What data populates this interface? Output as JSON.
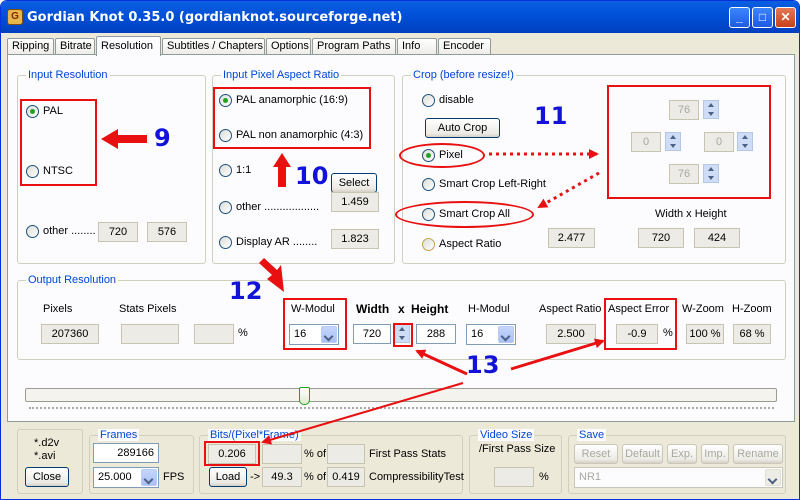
{
  "window": {
    "title": "Gordian Knot 0.35.0  (gordianknot.sourceforge.net)",
    "minimize": "_",
    "maximize": "□",
    "close": "✕"
  },
  "tabs": [
    "Ripping",
    "Bitrate",
    "Resolution",
    "Subtitles / Chapters",
    "Options",
    "Program Paths",
    "Info",
    "Encoder"
  ],
  "input_resolution": {
    "label": "Input Resolution",
    "pal": "PAL",
    "ntsc": "NTSC",
    "other": "other ........",
    "width": "720",
    "height": "576"
  },
  "pixel_aspect": {
    "label": "Input Pixel Aspect Ratio",
    "pal_anamorphic": "PAL anamorphic (16:9)",
    "pal_non_anamorphic": "PAL non anamorphic (4:3)",
    "one_to_one": "1:1",
    "select_button": "Select",
    "select_value": "1.459",
    "other": "other ..................",
    "display_ar": "Display AR ........",
    "display_ar_value": "1.823"
  },
  "crop": {
    "label": "Crop (before resize!)",
    "disable": "disable",
    "auto_crop": "Auto Crop",
    "pixel": "Pixel",
    "smart_left_right": "Smart Crop Left-Right",
    "smart_all": "Smart Crop All",
    "aspect_ratio": "Aspect Ratio",
    "aspect_ratio_value": "2.477",
    "top": "76",
    "left": "0",
    "right": "0",
    "bottom": "76",
    "wh_label": "Width x Height",
    "width": "720",
    "height": "424"
  },
  "output": {
    "label": "Output Resolution",
    "pixels_label": "Pixels",
    "pixels_value": "207360",
    "stats_pixels_label": "Stats Pixels",
    "percent": "%",
    "w_modul_label": "W-Modul",
    "w_modul": "16",
    "width_label": "Width",
    "x_label": "x",
    "height_label": "Height",
    "width": "720",
    "height": "288",
    "h_modul_label": "H-Modul",
    "h_modul": "16",
    "aspect_ratio_label": "Aspect Ratio",
    "aspect_ratio": "2.500",
    "aspect_error_label": "Aspect Error",
    "aspect_error": "-0.9",
    "w_zoom_label": "W-Zoom",
    "w_zoom": "100 %",
    "h_zoom_label": "H-Zoom",
    "h_zoom": "68 %"
  },
  "slider": {
    "value_fraction": 0.37
  },
  "files": {
    "d2v": "*.d2v",
    "avi": "*.avi",
    "close": "Close"
  },
  "frames": {
    "label": "Frames",
    "count": "289166",
    "fps": "25.000",
    "fps_label": "FPS"
  },
  "bpp": {
    "label": "Bits/(Pixel*Frame)",
    "value": "0.206",
    "of_label": "% of",
    "first_pass": "First Pass Stats",
    "load": "Load",
    "arrow": "->",
    "percent_value": "49.3",
    "of_label2": "% of",
    "compress_value": "0.419",
    "compress_test": "CompressibilityTest"
  },
  "video_size": {
    "label": "Video Size",
    "sublabel": "/First Pass Size",
    "percent": "%"
  },
  "save": {
    "label": "Save",
    "reset": "Reset",
    "default": "Default",
    "exp": "Exp.",
    "imp": "Imp.",
    "rename": "Rename",
    "profile": "NR1"
  },
  "annotations": [
    "9",
    "10",
    "11",
    "12",
    "13"
  ]
}
